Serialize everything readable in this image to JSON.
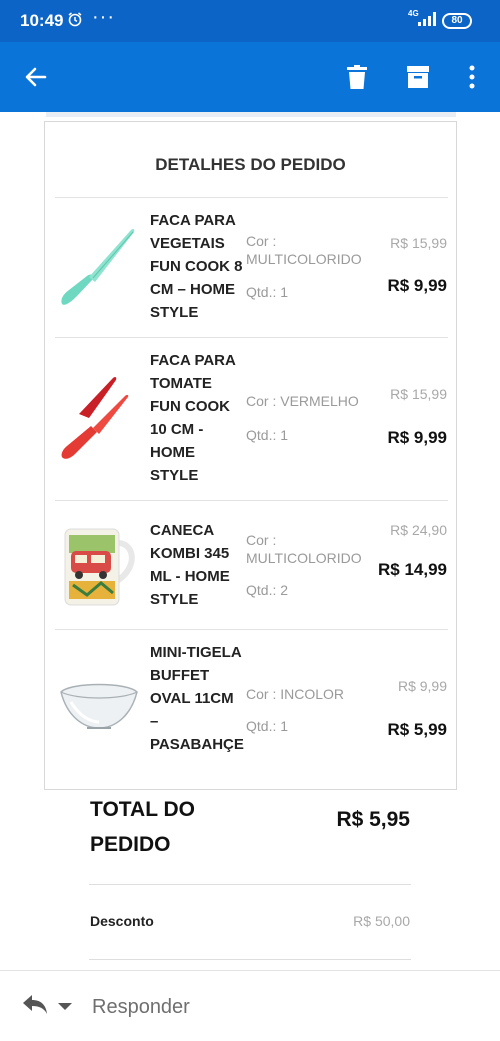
{
  "status_bar": {
    "time": "10:49",
    "alarm_icon": "alarm-clock-icon",
    "dots": "···",
    "network": "4G",
    "battery": "80"
  },
  "app_bar": {
    "color": "#0a74d9",
    "back_icon": "back-arrow-icon",
    "delete_icon": "trash-icon",
    "archive_icon": "archive-icon",
    "more_icon": "more-vertical-icon"
  },
  "order": {
    "title": "DETALHES DO PEDIDO",
    "items": [
      {
        "name": "FACA PARA VEGETAIS FUN COOK 8 CM – HOME STYLE",
        "color": "Cor : MULTICOLORIDO",
        "qty": "Qtd.: 1",
        "old_price": "R$ 15,99",
        "price": "R$ 9,99",
        "image": "green-knife-image"
      },
      {
        "name": "FACA PARA TOMATE FUN COOK 10 CM - HOME STYLE",
        "color": "Cor : VERMELHO",
        "qty": "Qtd.: 1",
        "old_price": "R$ 15,99",
        "price": "R$ 9,99",
        "image": "red-knife-image"
      },
      {
        "name": "CANECA KOMBI 345 ML - HOME STYLE",
        "color": "Cor : MULTICOLORIDO",
        "qty": "Qtd.: 2",
        "old_price": "R$ 24,90",
        "price": "R$ 14,99",
        "image": "mug-image"
      },
      {
        "name": "MINI-TIGELA BUFFET OVAL 11CM – PASABAHÇE",
        "color": "Cor : INCOLOR",
        "qty": "Qtd.: 1",
        "old_price": "R$ 9,99",
        "price": "R$ 5,99",
        "image": "glass-bowl-image"
      }
    ]
  },
  "summary": {
    "total_label": "TOTAL DO PEDIDO",
    "total_value": "R$ 5,95",
    "discount_label": "Desconto",
    "discount_value": "R$ 50,00"
  },
  "reply_bar": {
    "reply_icon": "reply-icon",
    "dropdown_icon": "caret-down-icon",
    "reply_label": "Responder"
  }
}
